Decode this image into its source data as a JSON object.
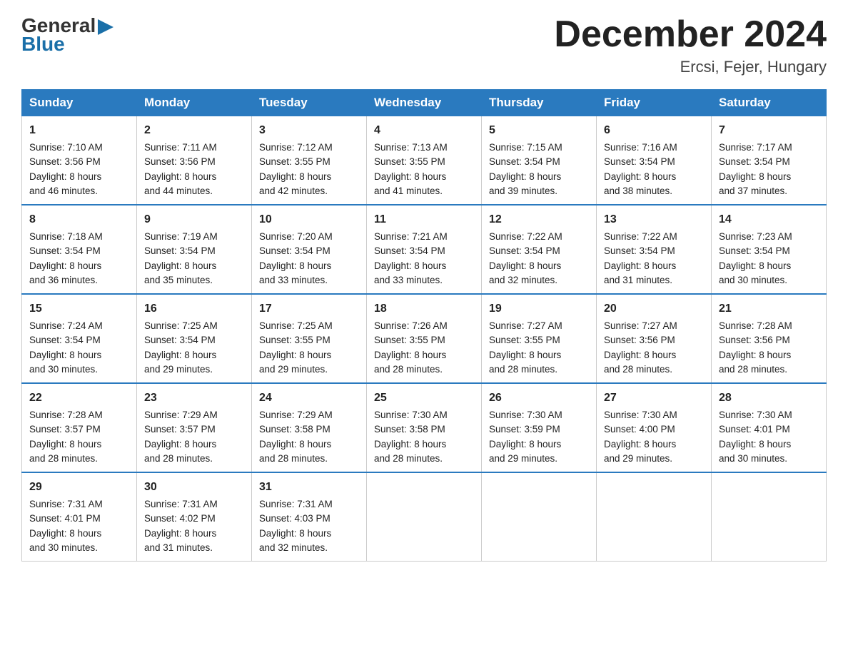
{
  "header": {
    "title": "December 2024",
    "subtitle": "Ercsi, Fejer, Hungary",
    "logo_general": "General",
    "logo_blue": "Blue"
  },
  "weekdays": [
    "Sunday",
    "Monday",
    "Tuesday",
    "Wednesday",
    "Thursday",
    "Friday",
    "Saturday"
  ],
  "weeks": [
    [
      {
        "day": "1",
        "sunrise": "7:10 AM",
        "sunset": "3:56 PM",
        "daylight": "8 hours and 46 minutes."
      },
      {
        "day": "2",
        "sunrise": "7:11 AM",
        "sunset": "3:56 PM",
        "daylight": "8 hours and 44 minutes."
      },
      {
        "day": "3",
        "sunrise": "7:12 AM",
        "sunset": "3:55 PM",
        "daylight": "8 hours and 42 minutes."
      },
      {
        "day": "4",
        "sunrise": "7:13 AM",
        "sunset": "3:55 PM",
        "daylight": "8 hours and 41 minutes."
      },
      {
        "day": "5",
        "sunrise": "7:15 AM",
        "sunset": "3:54 PM",
        "daylight": "8 hours and 39 minutes."
      },
      {
        "day": "6",
        "sunrise": "7:16 AM",
        "sunset": "3:54 PM",
        "daylight": "8 hours and 38 minutes."
      },
      {
        "day": "7",
        "sunrise": "7:17 AM",
        "sunset": "3:54 PM",
        "daylight": "8 hours and 37 minutes."
      }
    ],
    [
      {
        "day": "8",
        "sunrise": "7:18 AM",
        "sunset": "3:54 PM",
        "daylight": "8 hours and 36 minutes."
      },
      {
        "day": "9",
        "sunrise": "7:19 AM",
        "sunset": "3:54 PM",
        "daylight": "8 hours and 35 minutes."
      },
      {
        "day": "10",
        "sunrise": "7:20 AM",
        "sunset": "3:54 PM",
        "daylight": "8 hours and 33 minutes."
      },
      {
        "day": "11",
        "sunrise": "7:21 AM",
        "sunset": "3:54 PM",
        "daylight": "8 hours and 33 minutes."
      },
      {
        "day": "12",
        "sunrise": "7:22 AM",
        "sunset": "3:54 PM",
        "daylight": "8 hours and 32 minutes."
      },
      {
        "day": "13",
        "sunrise": "7:22 AM",
        "sunset": "3:54 PM",
        "daylight": "8 hours and 31 minutes."
      },
      {
        "day": "14",
        "sunrise": "7:23 AM",
        "sunset": "3:54 PM",
        "daylight": "8 hours and 30 minutes."
      }
    ],
    [
      {
        "day": "15",
        "sunrise": "7:24 AM",
        "sunset": "3:54 PM",
        "daylight": "8 hours and 30 minutes."
      },
      {
        "day": "16",
        "sunrise": "7:25 AM",
        "sunset": "3:54 PM",
        "daylight": "8 hours and 29 minutes."
      },
      {
        "day": "17",
        "sunrise": "7:25 AM",
        "sunset": "3:55 PM",
        "daylight": "8 hours and 29 minutes."
      },
      {
        "day": "18",
        "sunrise": "7:26 AM",
        "sunset": "3:55 PM",
        "daylight": "8 hours and 28 minutes."
      },
      {
        "day": "19",
        "sunrise": "7:27 AM",
        "sunset": "3:55 PM",
        "daylight": "8 hours and 28 minutes."
      },
      {
        "day": "20",
        "sunrise": "7:27 AM",
        "sunset": "3:56 PM",
        "daylight": "8 hours and 28 minutes."
      },
      {
        "day": "21",
        "sunrise": "7:28 AM",
        "sunset": "3:56 PM",
        "daylight": "8 hours and 28 minutes."
      }
    ],
    [
      {
        "day": "22",
        "sunrise": "7:28 AM",
        "sunset": "3:57 PM",
        "daylight": "8 hours and 28 minutes."
      },
      {
        "day": "23",
        "sunrise": "7:29 AM",
        "sunset": "3:57 PM",
        "daylight": "8 hours and 28 minutes."
      },
      {
        "day": "24",
        "sunrise": "7:29 AM",
        "sunset": "3:58 PM",
        "daylight": "8 hours and 28 minutes."
      },
      {
        "day": "25",
        "sunrise": "7:30 AM",
        "sunset": "3:58 PM",
        "daylight": "8 hours and 28 minutes."
      },
      {
        "day": "26",
        "sunrise": "7:30 AM",
        "sunset": "3:59 PM",
        "daylight": "8 hours and 29 minutes."
      },
      {
        "day": "27",
        "sunrise": "7:30 AM",
        "sunset": "4:00 PM",
        "daylight": "8 hours and 29 minutes."
      },
      {
        "day": "28",
        "sunrise": "7:30 AM",
        "sunset": "4:01 PM",
        "daylight": "8 hours and 30 minutes."
      }
    ],
    [
      {
        "day": "29",
        "sunrise": "7:31 AM",
        "sunset": "4:01 PM",
        "daylight": "8 hours and 30 minutes."
      },
      {
        "day": "30",
        "sunrise": "7:31 AM",
        "sunset": "4:02 PM",
        "daylight": "8 hours and 31 minutes."
      },
      {
        "day": "31",
        "sunrise": "7:31 AM",
        "sunset": "4:03 PM",
        "daylight": "8 hours and 32 minutes."
      },
      null,
      null,
      null,
      null
    ]
  ]
}
